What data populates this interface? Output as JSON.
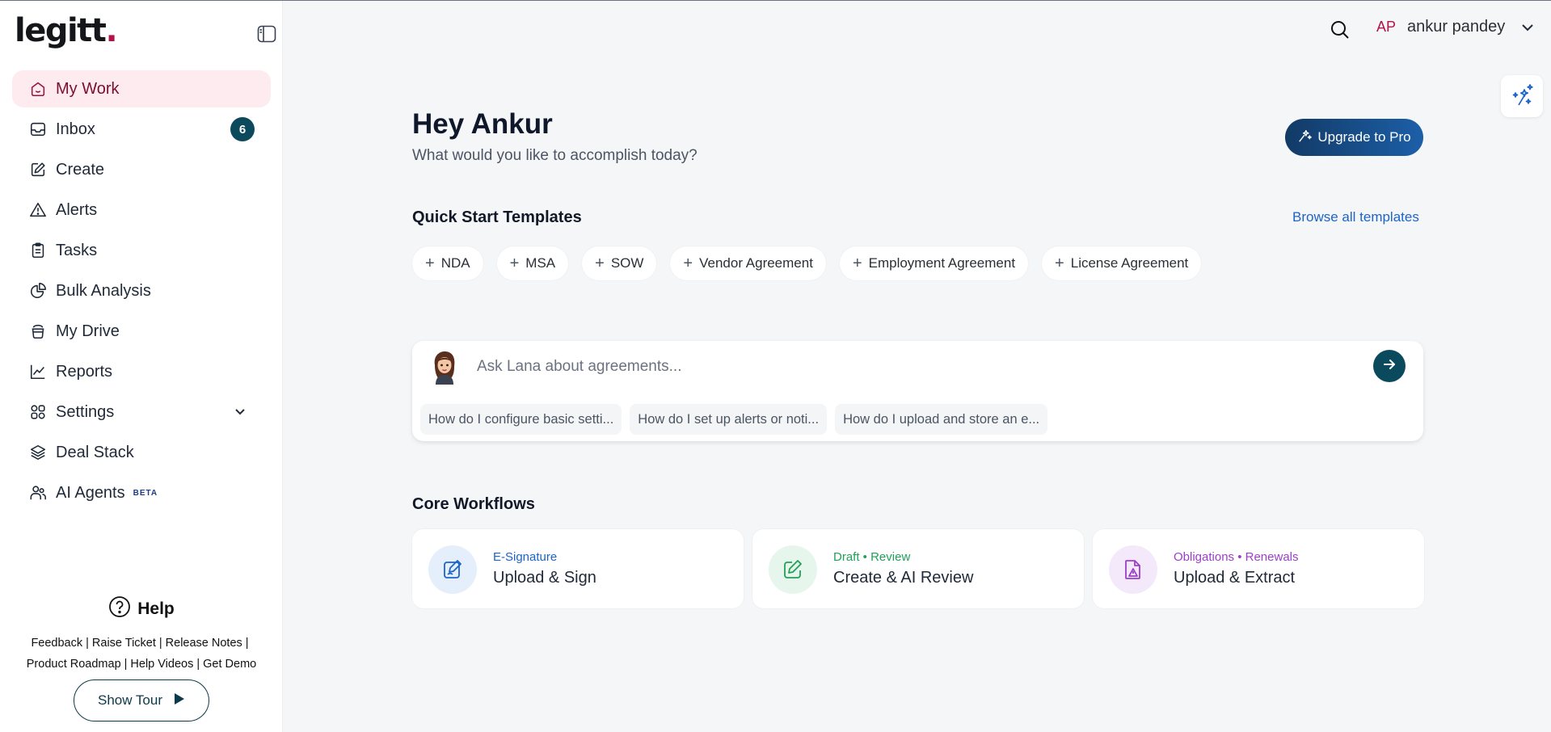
{
  "brand": {
    "name": "legitt",
    "dot": "."
  },
  "sidebar": {
    "items": [
      {
        "label": "My Work"
      },
      {
        "label": "Inbox",
        "badge": "6"
      },
      {
        "label": "Create"
      },
      {
        "label": "Alerts"
      },
      {
        "label": "Tasks"
      },
      {
        "label": "Bulk Analysis"
      },
      {
        "label": "My Drive"
      },
      {
        "label": "Reports"
      },
      {
        "label": "Settings"
      },
      {
        "label": "Deal Stack"
      },
      {
        "label": "AI Agents",
        "tag": "BETA"
      }
    ],
    "help": {
      "title": "Help",
      "links": [
        "Feedback",
        "Raise Ticket",
        "Release Notes",
        "Product Roadmap",
        "Help Videos",
        "Get Demo"
      ],
      "separator": "|"
    },
    "show_tour": "Show Tour"
  },
  "topbar": {
    "user_initials": "AP",
    "user_name": "ankur pandey"
  },
  "main": {
    "greeting": "Hey Ankur",
    "subtitle": "What would you like to accomplish today?",
    "upgrade_label": "Upgrade to Pro",
    "quick_start": {
      "title": "Quick Start Templates",
      "browse_label": "Browse all templates",
      "templates": [
        "NDA",
        "MSA",
        "SOW",
        "Vendor Agreement",
        "Employment Agreement",
        "License Agreement"
      ]
    },
    "ask": {
      "placeholder": "Ask Lana about agreements...",
      "suggestions": [
        "How do I configure basic setti...",
        "How do I set up alerts or noti...",
        "How do I upload and store an e..."
      ]
    },
    "core_workflows": {
      "title": "Core Workflows",
      "cards": [
        {
          "tag": "E-Signature",
          "name": "Upload & Sign",
          "tag_color": "#1d64c8",
          "icon": "signature-icon"
        },
        {
          "tag": "Draft • Review",
          "name": "Create & AI Review",
          "tag_color": "#22a05a",
          "icon": "edit-icon"
        },
        {
          "tag": "Obligations • Renewals",
          "name": "Upload & Extract",
          "tag_color": "#9b3fc9",
          "icon": "document-alert-icon"
        }
      ]
    }
  },
  "colors": {
    "accent": "#0b4a5c",
    "brand": "#b3124a",
    "active_bg": "#fdebf0",
    "link": "#1d64c8"
  }
}
